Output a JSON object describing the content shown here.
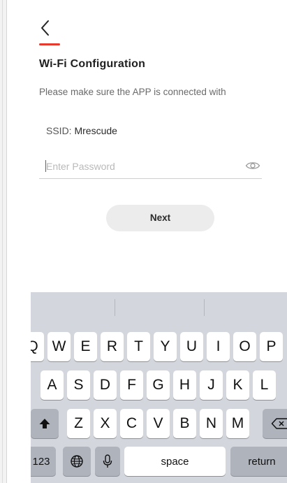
{
  "header": {
    "accent_color": "#e63a2e",
    "back_icon": "chevron-left-icon"
  },
  "page": {
    "title": "Wi-Fi Configuration",
    "subtitle": "Please make sure the APP is connected with",
    "ssid_label": "SSID:",
    "ssid_value": "Mrescude",
    "password_placeholder": "Enter Password",
    "password_value": "",
    "visibility_icon": "eye-icon",
    "next_label": "Next"
  },
  "keyboard": {
    "row1": [
      "Q",
      "W",
      "E",
      "R",
      "T",
      "Y",
      "U",
      "I",
      "O",
      "P"
    ],
    "row2": [
      "A",
      "S",
      "D",
      "F",
      "G",
      "H",
      "J",
      "K",
      "L"
    ],
    "row3": [
      "Z",
      "X",
      "C",
      "V",
      "B",
      "N",
      "M"
    ],
    "shift_icon": "shift-icon",
    "delete_icon": "backspace-icon",
    "numbers_label": "123",
    "globe_icon": "globe-icon",
    "mic_icon": "microphone-icon",
    "space_label": "space",
    "return_label": "return"
  }
}
